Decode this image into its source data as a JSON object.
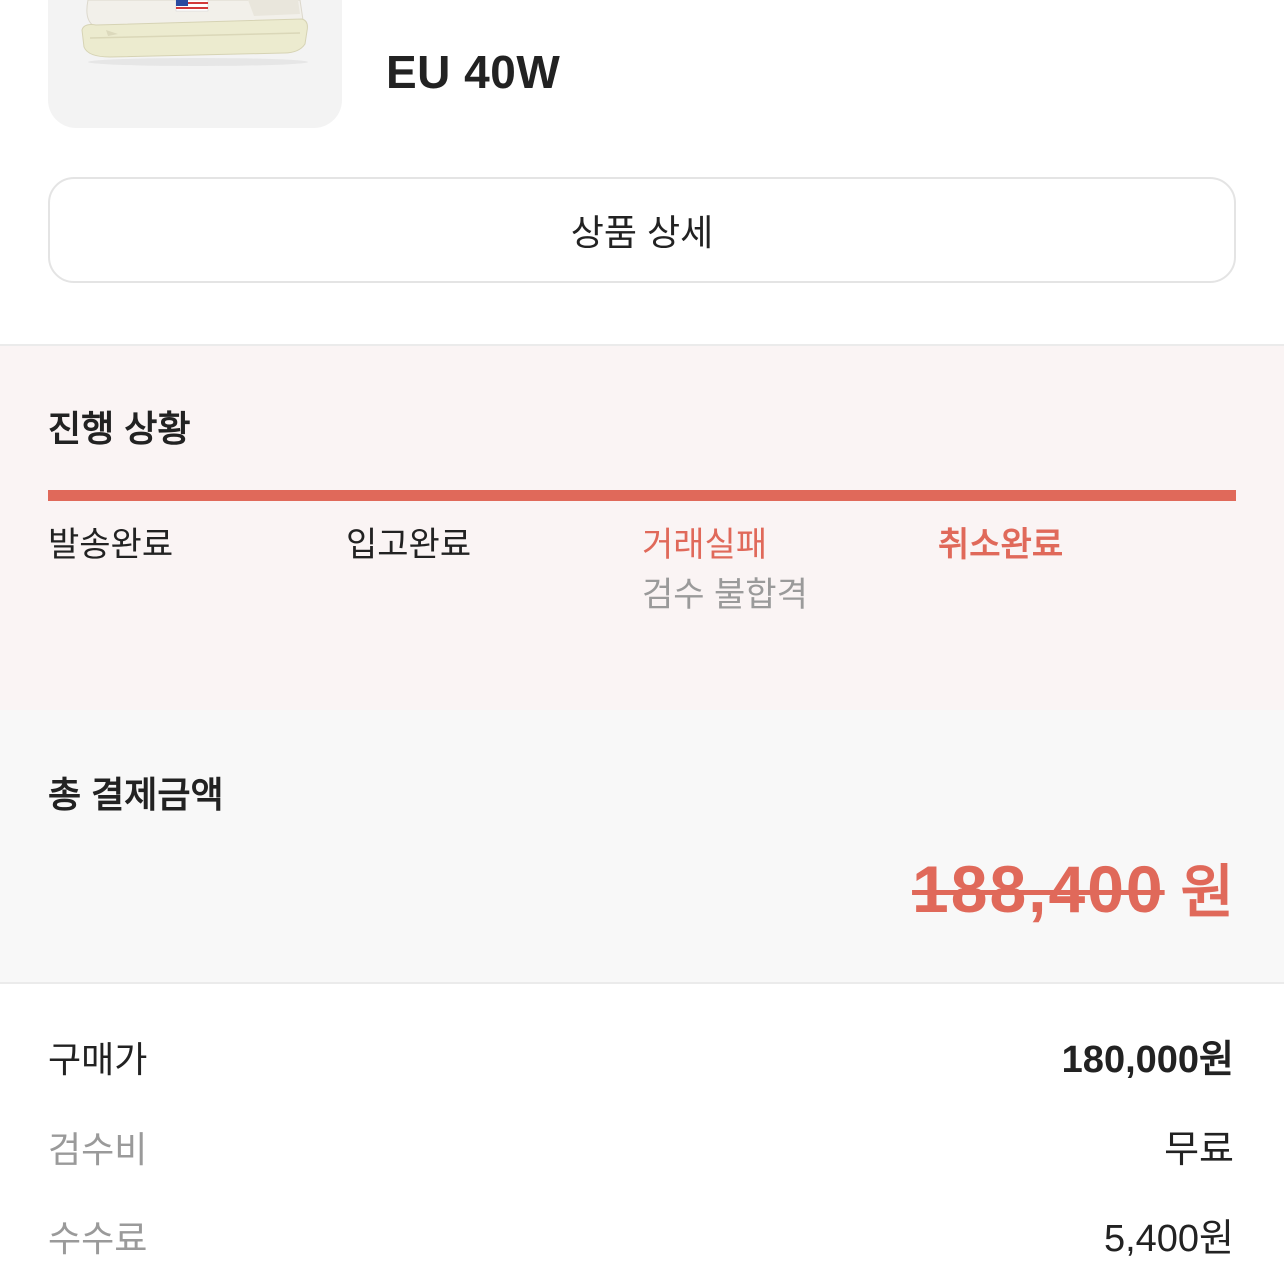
{
  "product": {
    "size": "EU 40W",
    "image_icon": "sneaker-image"
  },
  "detail_button": {
    "label": "상품 상세"
  },
  "progress": {
    "title": "진행 상황",
    "fill_percent": 100,
    "steps": [
      {
        "label": "발송완료"
      },
      {
        "label": "입고완료"
      },
      {
        "label": "거래실패",
        "sub": "검수 불합격"
      },
      {
        "label": "취소완료"
      }
    ]
  },
  "total": {
    "title": "총 결제금액",
    "amount": "188,400",
    "unit": "원"
  },
  "breakdown": [
    {
      "label": "구매가",
      "value": "180,000원"
    },
    {
      "label": "검수비",
      "value": "무료"
    },
    {
      "label": "수수료",
      "value": "5,400원"
    }
  ],
  "colors": {
    "accent": "#e0695a",
    "text": "#222222",
    "muted": "#9a9a9a",
    "progress_background": "#faf4f4",
    "total_background": "#f8f8f8"
  }
}
